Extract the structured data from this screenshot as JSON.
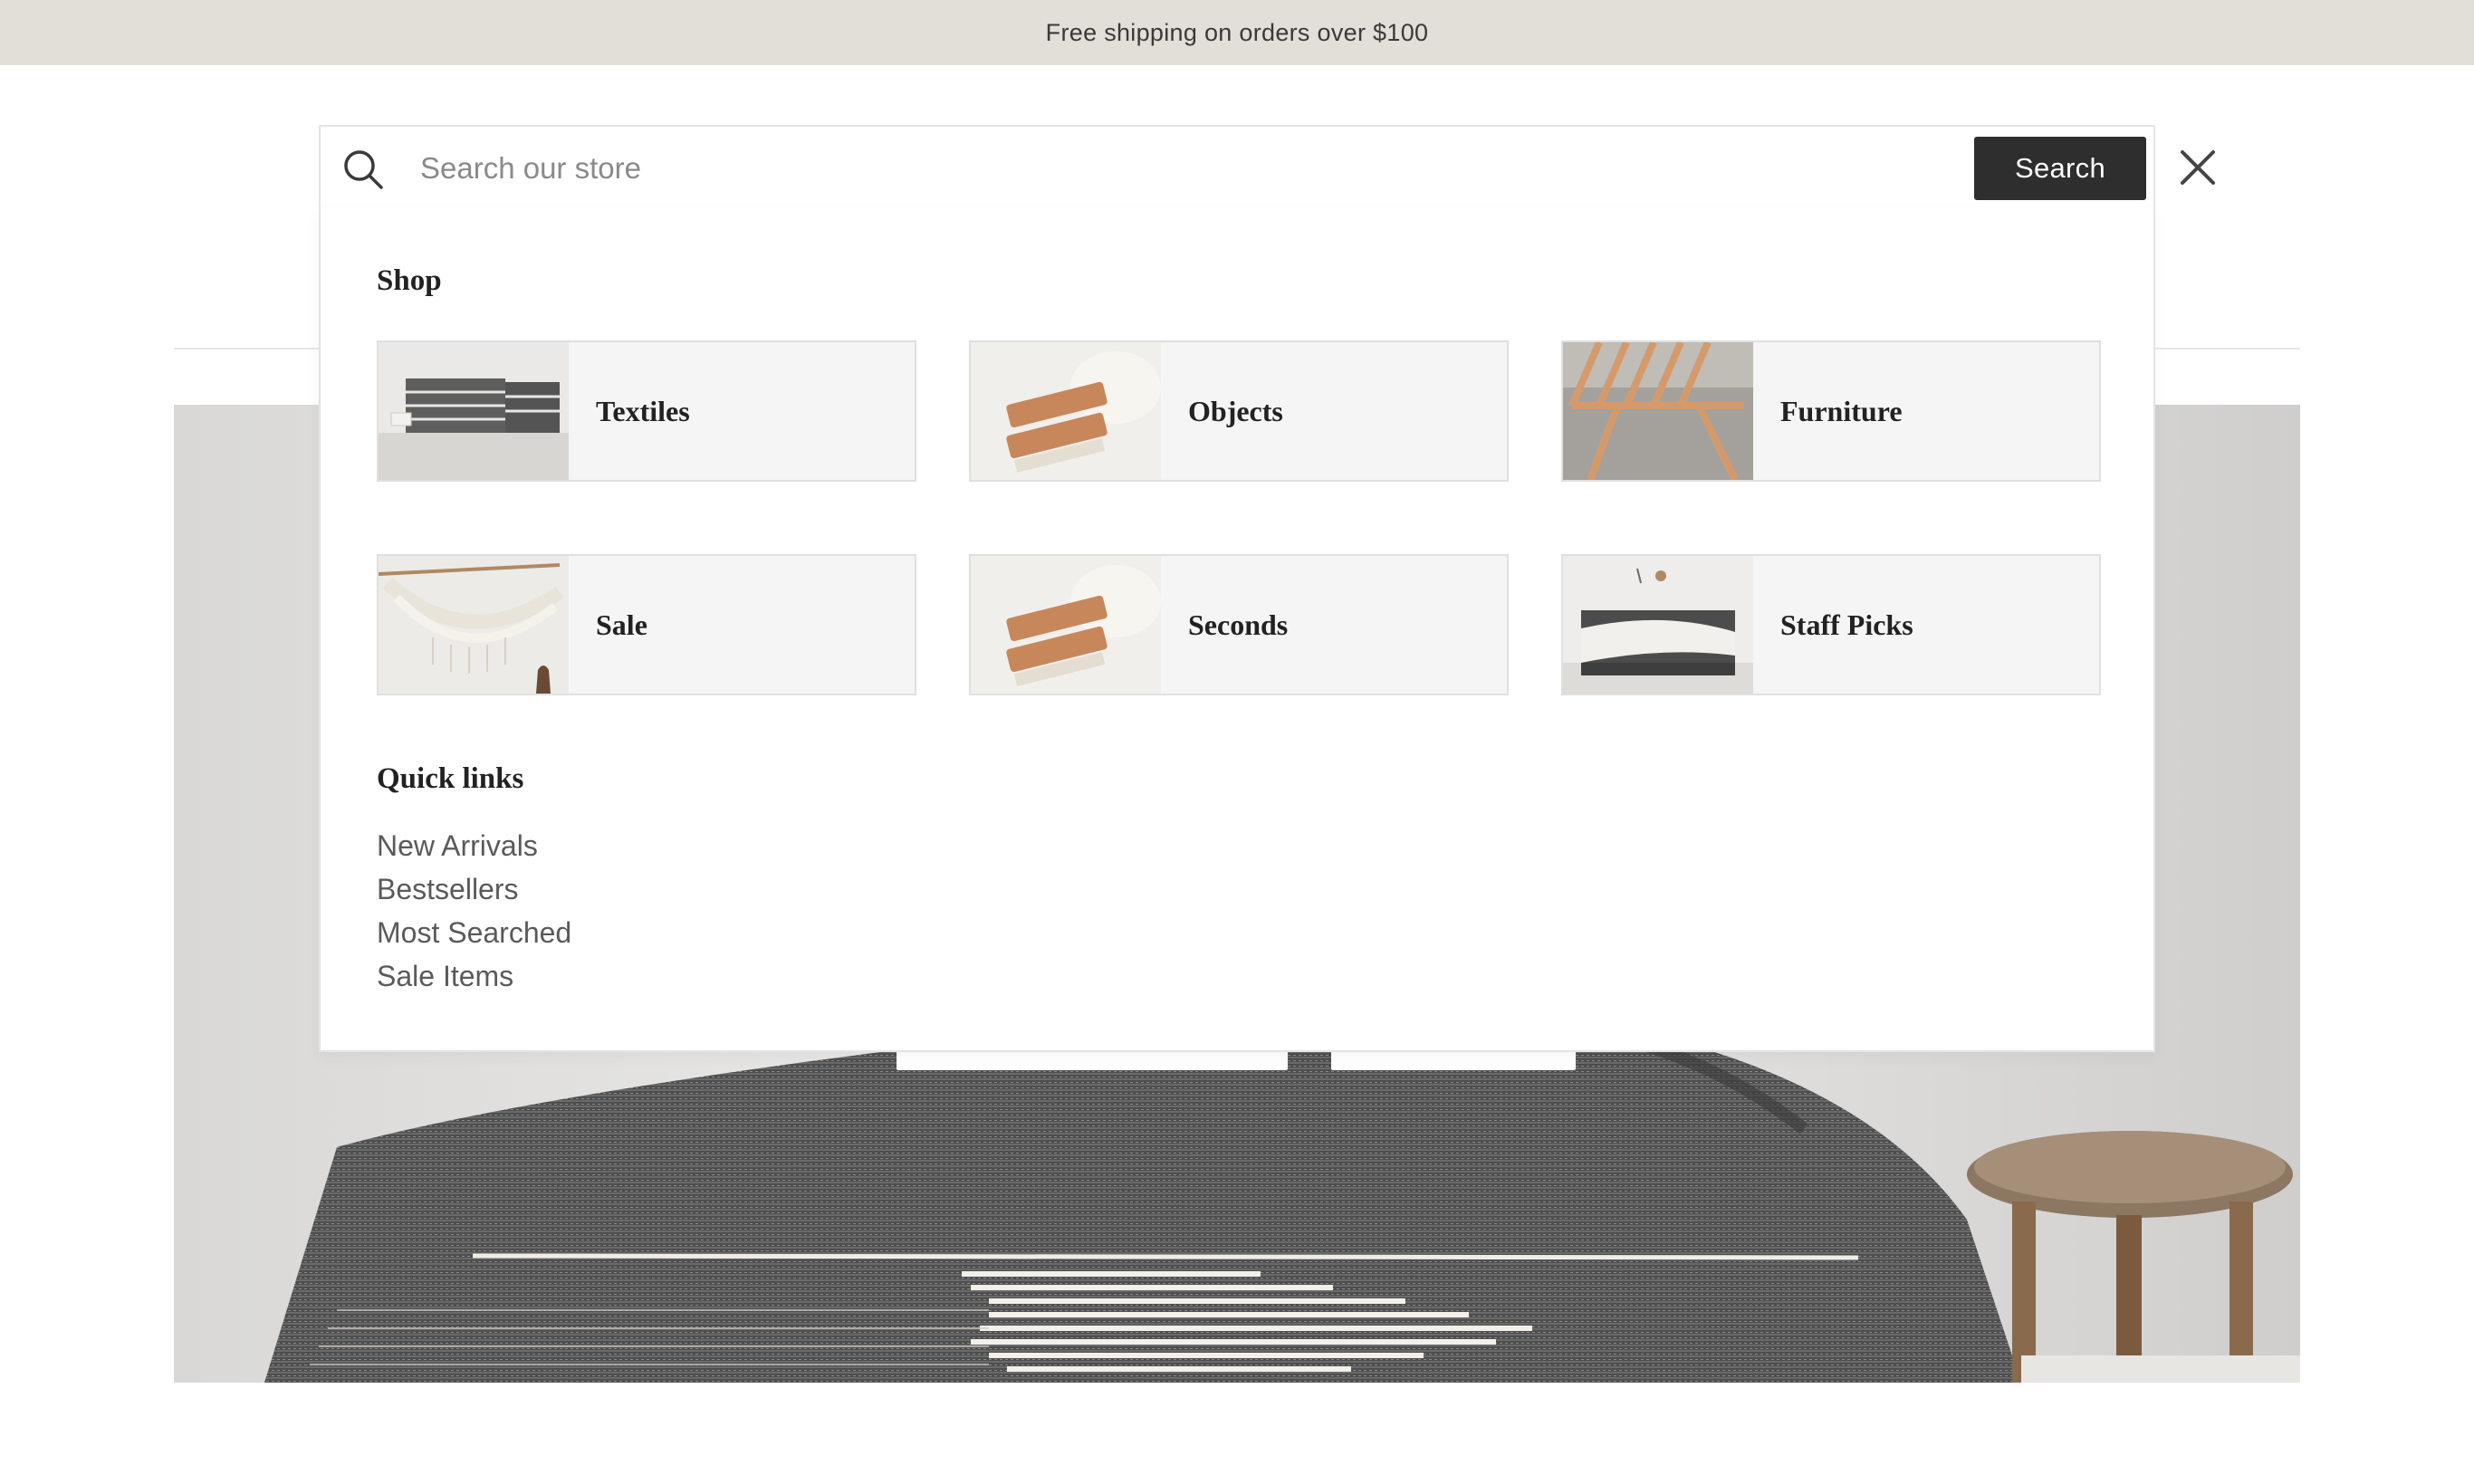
{
  "announcement": {
    "text": "Free shipping on orders over $100"
  },
  "search": {
    "placeholder": "Search our store",
    "value": "",
    "button_label": "Search"
  },
  "panel": {
    "shop_title": "Shop",
    "categories": [
      {
        "label": "Textiles",
        "image": "folded-striped-towels"
      },
      {
        "label": "Objects",
        "image": "wooden-brushes"
      },
      {
        "label": "Furniture",
        "image": "wooden-folding-chair"
      },
      {
        "label": "Sale",
        "image": "hanging-hammock"
      },
      {
        "label": "Seconds",
        "image": "wooden-brushes"
      },
      {
        "label": "Staff Picks",
        "image": "bed-with-throw"
      }
    ],
    "quick_title": "Quick links",
    "quick_links": [
      "New Arrivals",
      "Bestsellers",
      "Most Searched",
      "Sale Items"
    ]
  },
  "colors": {
    "announcement_bg": "#e2ded8",
    "search_button_bg": "#2e2e2e",
    "card_bg": "#f5f5f5"
  },
  "icons": {
    "search": "search-icon",
    "close": "close-icon"
  }
}
